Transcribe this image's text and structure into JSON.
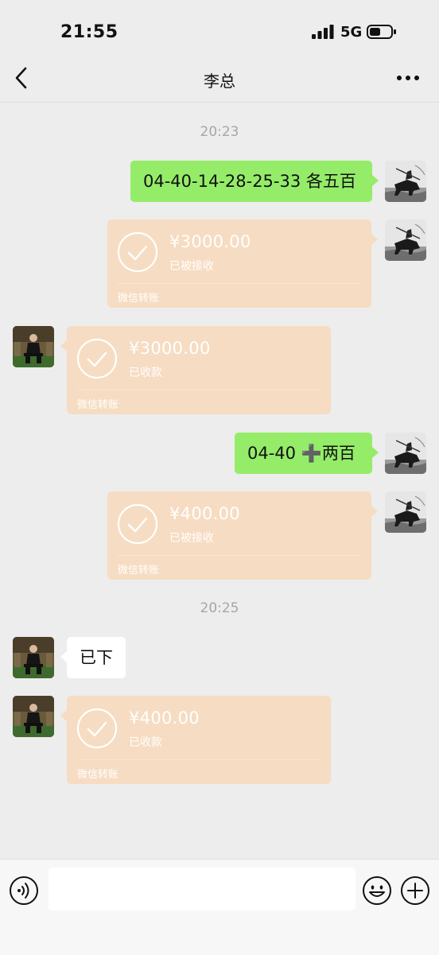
{
  "status_bar": {
    "time": "21:55",
    "network": "5G"
  },
  "nav": {
    "title": "李总"
  },
  "messages": [
    {
      "type": "timestamp",
      "text": "20:23"
    },
    {
      "type": "text",
      "direction": "out",
      "text": "04-40-14-28-25-33 各五百"
    },
    {
      "type": "transfer",
      "direction": "out",
      "amount": "¥3000.00",
      "status": "已被接收",
      "brand": "微信转账"
    },
    {
      "type": "transfer",
      "direction": "in",
      "amount": "¥3000.00",
      "status": "已收款",
      "brand": "微信转账"
    },
    {
      "type": "text",
      "direction": "out",
      "text": "04-40 ➕两百"
    },
    {
      "type": "transfer",
      "direction": "out",
      "amount": "¥400.00",
      "status": "已被接收",
      "brand": "微信转账"
    },
    {
      "type": "timestamp",
      "text": "20:25"
    },
    {
      "type": "text",
      "direction": "in",
      "text": "已下"
    },
    {
      "type": "transfer",
      "direction": "in",
      "amount": "¥400.00",
      "status": "已收款",
      "brand": "微信转账"
    }
  ],
  "input_bar": {
    "placeholder": ""
  },
  "colors": {
    "background": "#ededed",
    "bubble_out": "#95ec69",
    "bubble_in": "#ffffff",
    "transfer_card": "#f6dcc2",
    "timestamp_text": "#a6a6a6"
  },
  "icons": {
    "back": "chevron-left-icon",
    "more": "more-dots-icon",
    "voice": "voice-icon",
    "emoji": "emoji-icon",
    "plus": "plus-icon",
    "transfer_check": "check-circle-icon"
  }
}
